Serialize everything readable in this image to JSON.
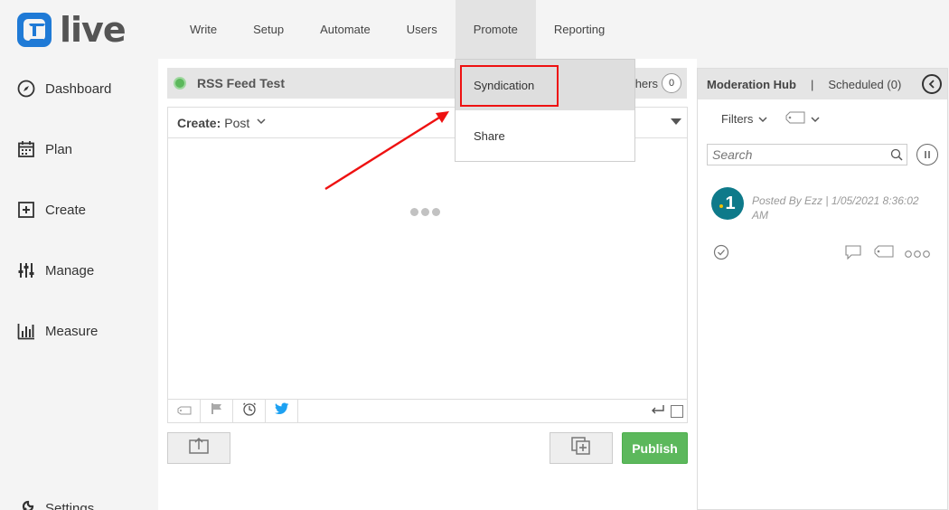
{
  "app": {
    "logo_text": "live",
    "brand_color": "#1f7ad6"
  },
  "nav": {
    "items": [
      {
        "label": "Write"
      },
      {
        "label": "Setup"
      },
      {
        "label": "Automate"
      },
      {
        "label": "Users"
      },
      {
        "label": "Promote",
        "active": true
      },
      {
        "label": "Reporting"
      }
    ]
  },
  "promote_menu": {
    "items": [
      {
        "label": "Syndication",
        "highlighted": true
      },
      {
        "label": "Share"
      }
    ],
    "highlight_color": "#ee1111"
  },
  "sidebar": {
    "items": [
      {
        "label": "Dashboard",
        "icon": "compass-icon"
      },
      {
        "label": "Plan",
        "icon": "calendar-icon"
      },
      {
        "label": "Create",
        "icon": "plus-square-icon"
      },
      {
        "label": "Manage",
        "icon": "sliders-icon"
      },
      {
        "label": "Measure",
        "icon": "bar-chart-icon"
      },
      {
        "label": "Settings",
        "icon": "wrench-icon"
      }
    ]
  },
  "feed": {
    "title": "RSS Feed Test",
    "status_color": "#5cb85c",
    "others_label": "hers",
    "others_count": "0"
  },
  "editor": {
    "create_label": "Create:",
    "create_type": "Post",
    "loading": true
  },
  "actions": {
    "publish_label": "Publish",
    "publish_color": "#5cb85c"
  },
  "right_panel": {
    "tab_moderation": "Moderation Hub",
    "separator": "|",
    "tab_scheduled": "Scheduled (0)",
    "filters_label": "Filters",
    "search_placeholder": "Search",
    "post": {
      "avatar_text": "1",
      "meta": "Posted By Ezz | 1/05/2021 8:36:02 AM"
    }
  }
}
